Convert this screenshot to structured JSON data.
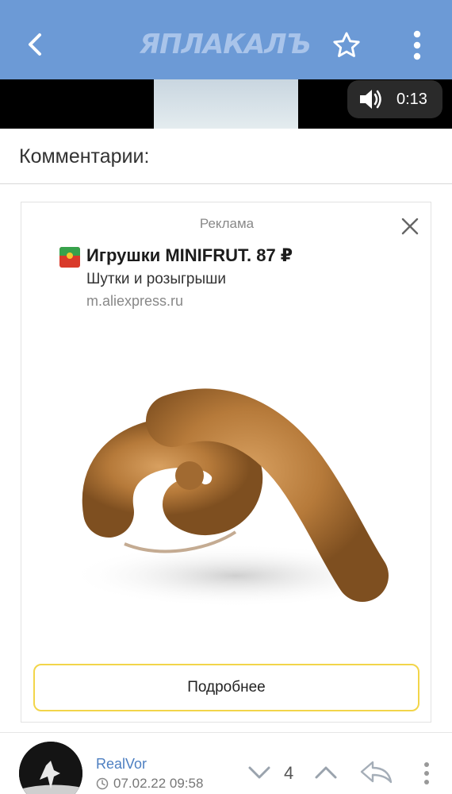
{
  "app": {
    "logo_text": "ЯПЛАКАЛЪ",
    "bar_color": "#6c9ad6"
  },
  "icons": {
    "back": "back-arrow-icon",
    "star": "star-icon",
    "more": "more-vertical-icon",
    "volume": "volume-icon",
    "close": "close-icon",
    "clock": "clock-icon",
    "vote_down": "chevron-down-icon",
    "vote_up": "chevron-up-icon",
    "reply": "reply-icon"
  },
  "video": {
    "time": "0:13"
  },
  "comments": {
    "header": "Комментарии:"
  },
  "ad": {
    "label": "Реклама",
    "title": "Игрушки MINIFRUT. 87 ₽",
    "subtitle": "Шутки и розыгрыши",
    "domain": "m.aliexpress.ru",
    "button_label": "Подробнее",
    "button_border_color": "#f2d54a"
  },
  "comment": {
    "username": "RealVor",
    "date": "07.02.22 09:58",
    "votes": "4"
  }
}
